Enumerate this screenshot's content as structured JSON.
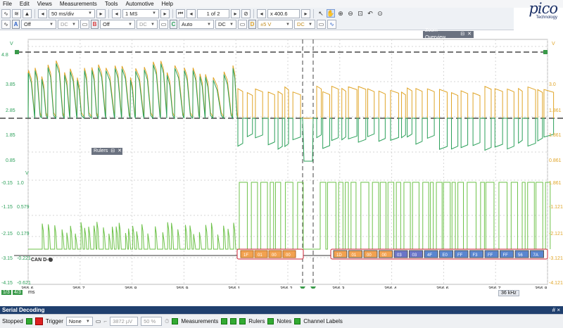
{
  "menu": [
    "File",
    "Edit",
    "Views",
    "Measurements",
    "Tools",
    "Automotive",
    "Help"
  ],
  "logo": {
    "word": "pico",
    "sub": "Technology"
  },
  "toolbar1": {
    "timebase": "50 ms/div",
    "samples": "1 MS",
    "buffer": "1 of 2",
    "zoom": "x 400.6"
  },
  "toolbar2": {
    "channels": [
      {
        "letter": "A",
        "color": "#2d62c9",
        "range": "Off",
        "coupling": "DC"
      },
      {
        "letter": "B",
        "color": "#d83a3a",
        "range": "Off",
        "coupling": "DC"
      },
      {
        "letter": "C",
        "color": "#2ca05a",
        "range": "Auto",
        "coupling": "DC"
      },
      {
        "letter": "D",
        "color": "#e0a528",
        "range": "±5 V",
        "coupling": "DC"
      }
    ]
  },
  "panels": {
    "zoom_overview": "Zoom Overview",
    "rulers": "Rulers"
  },
  "upper_axis": {
    "unit": "V",
    "left_ticks": [
      "3.85",
      "2.85",
      "1.85",
      "0.85"
    ],
    "left_top": "4.8",
    "right_ticks": [
      "3.0",
      "1.861",
      "1.861",
      "0.861"
    ]
  },
  "lower_axis": {
    "unit": "V",
    "left_outer": [
      "-0.15",
      "-1.15",
      "-2.15",
      "-3.15",
      "-4.15"
    ],
    "left_inner": [
      "1.0",
      "0.579",
      "0.179",
      "-0.221",
      "-0.621"
    ],
    "right_ticks": [
      "1.861",
      "-1.121",
      "-2.121",
      "-3.121",
      "-4.121"
    ]
  },
  "decode_label": "CAN D-C",
  "decode_packets_left": [
    "1F",
    "01",
    "00",
    "00"
  ],
  "decode_packets_right": [
    "1D",
    "01",
    "00",
    "00",
    "03",
    "03",
    "4F",
    "E0",
    "FF",
    "F3",
    "FF",
    "FF",
    "56",
    "7A"
  ],
  "x_axis": {
    "ticks": [
      "355.6",
      "355.7",
      "355.8",
      "355.9",
      "356.1",
      "356.2",
      "356.3",
      "356.4",
      "356.6",
      "356.7",
      "356.8"
    ],
    "unit": "ms"
  },
  "status": {
    "left": "1/3",
    "mid": "4/3",
    "freq": "36 kHz"
  },
  "serial": {
    "title": "Serial Decoding",
    "right": "#  ×"
  },
  "bottom": {
    "state": "Stopped",
    "trigger_label": "Trigger",
    "trigger_mode": "None",
    "level": "3872 µV",
    "percent": "50 %",
    "measurements": "Measurements",
    "rulers": "Rulers",
    "notes": "Notes",
    "channel_labels": "Channel Labels"
  },
  "colors": {
    "green": "#2ca05a",
    "orange": "#e0a528",
    "light_green": "#6ec24a",
    "packet_orange": "#f2a250",
    "packet_purple": "#6a75c8",
    "packet_blue": "#5a86d0"
  }
}
